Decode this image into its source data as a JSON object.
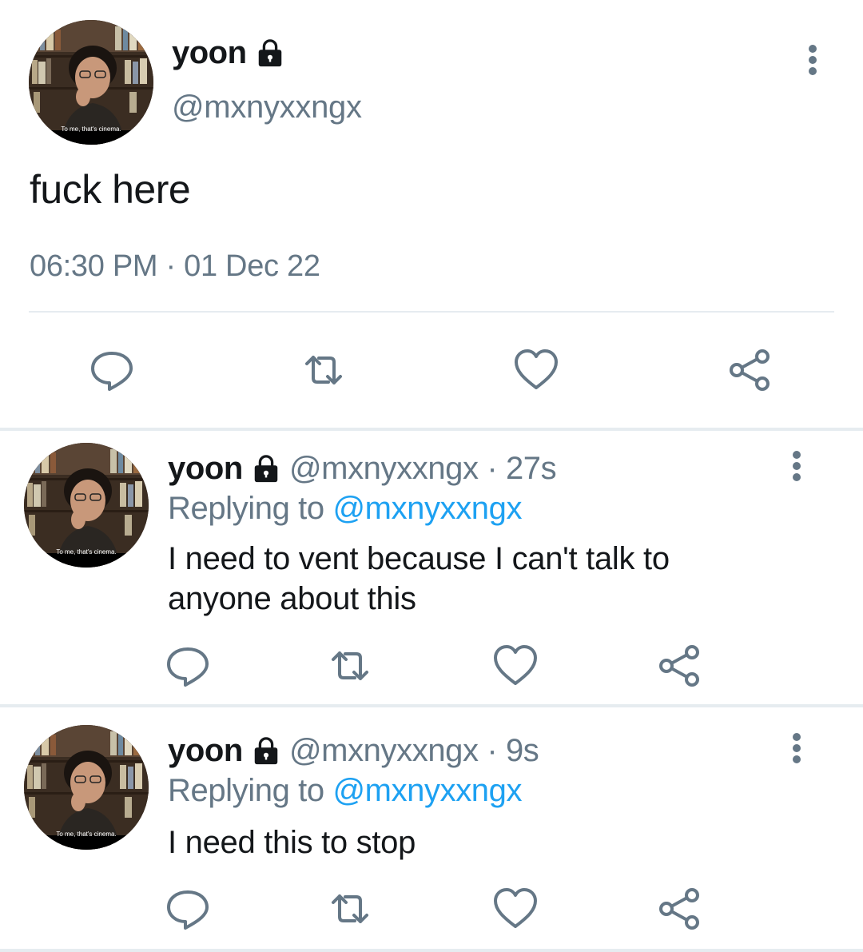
{
  "main": {
    "name": "yoon",
    "handle": "@mxnyxxngx",
    "text": "fuck here",
    "timestamp": "06:30 PM · 01 Dec 22",
    "avatar_caption": "To me, that's cinema."
  },
  "replies": [
    {
      "name": "yoon",
      "meta": "@mxnyxxngx · 27s",
      "replying_prefix": "Replying to",
      "replying_handle": "@mxnyxxngx",
      "text": "I need to vent because I can't talk to anyone about this",
      "avatar_caption": "To me, that's cinema."
    },
    {
      "name": "yoon",
      "meta": "@mxnyxxngx · 9s",
      "replying_prefix": "Replying to",
      "replying_handle": "@mxnyxxngx",
      "text": "I need this to stop",
      "avatar_caption": "To me, that's cinema."
    }
  ],
  "icons": {
    "lock": "lock-icon",
    "more": "more-vertical-icon",
    "reply": "reply-icon",
    "retweet": "retweet-icon",
    "like": "heart-icon",
    "share": "share-icon"
  },
  "colors": {
    "text": "#14171a",
    "secondary": "#657786",
    "link": "#1da1f2",
    "divider": "#e6ecf0"
  }
}
